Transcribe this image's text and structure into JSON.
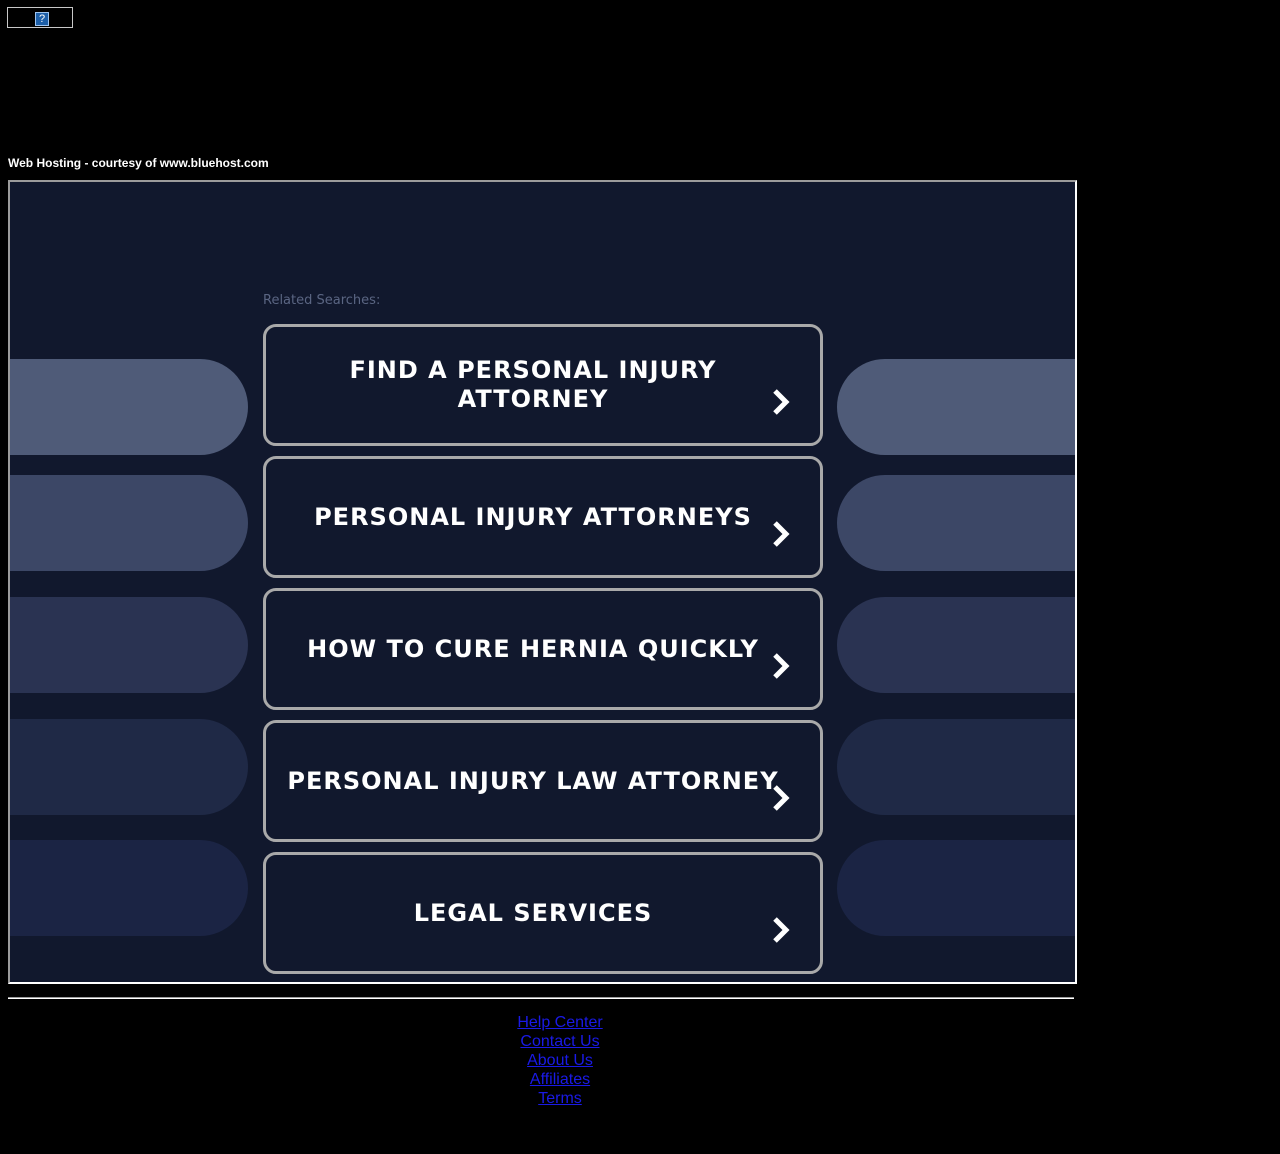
{
  "logo": {
    "glyph": "?"
  },
  "hosting_text": "Web Hosting - courtesy of www.bluehost.com",
  "related_label": "Related Searches:",
  "results": [
    "FIND A PERSONAL INJURY ATTORNEY",
    "PERSONAL INJURY ATTORNEYS",
    "HOW TO CURE HERNIA QUICKLY",
    "PERSONAL INJURY LAW ATTORNEY",
    "LEGAL SERVICES"
  ],
  "decor_colors": [
    "#4f5b78",
    "#3c4766",
    "#2a3352",
    "#1f2946",
    "#1b2444"
  ],
  "footer_links": [
    "Help Center",
    "Contact Us",
    "About Us",
    "Affiliates",
    "Terms"
  ],
  "colors": {
    "frame_bg": "#11182d",
    "link": "#1a1ae6"
  }
}
